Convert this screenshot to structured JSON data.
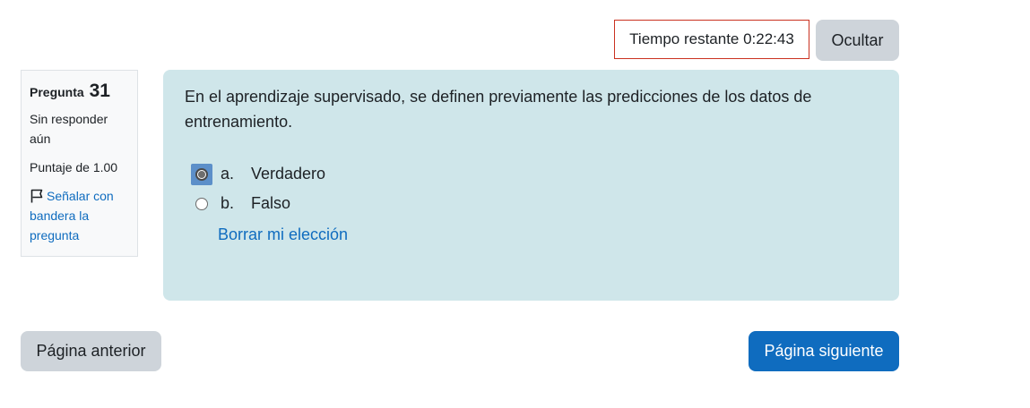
{
  "timer": {
    "label": "Tiempo restante",
    "value": "0:22:43"
  },
  "timer_text": "Tiempo restante 0:22:43",
  "hide_button_label": "Ocultar",
  "question_info": {
    "label": "Pregunta",
    "number": "31",
    "state": "Sin responder aún",
    "grade": "Puntaje de 1.00",
    "flag_label": "Señalar con bandera la pregunta",
    "flag_icon": "flag-icon"
  },
  "question": {
    "text": "En el aprendizaje supervisado, se definen previamente las predicciones de los datos de entrenamiento.",
    "answers": [
      {
        "letter": "a.",
        "label": "Verdadero",
        "selected": true
      },
      {
        "letter": "b.",
        "label": "Falso",
        "selected": false
      }
    ],
    "clear_choice_label": "Borrar mi elección"
  },
  "navigation": {
    "prev_label": "Página anterior",
    "next_label": "Página siguiente"
  },
  "colors": {
    "primary": "#0f6cbf",
    "secondary": "#ced4da",
    "content_bg": "#cfe6ea",
    "timer_border": "#ca3120"
  }
}
